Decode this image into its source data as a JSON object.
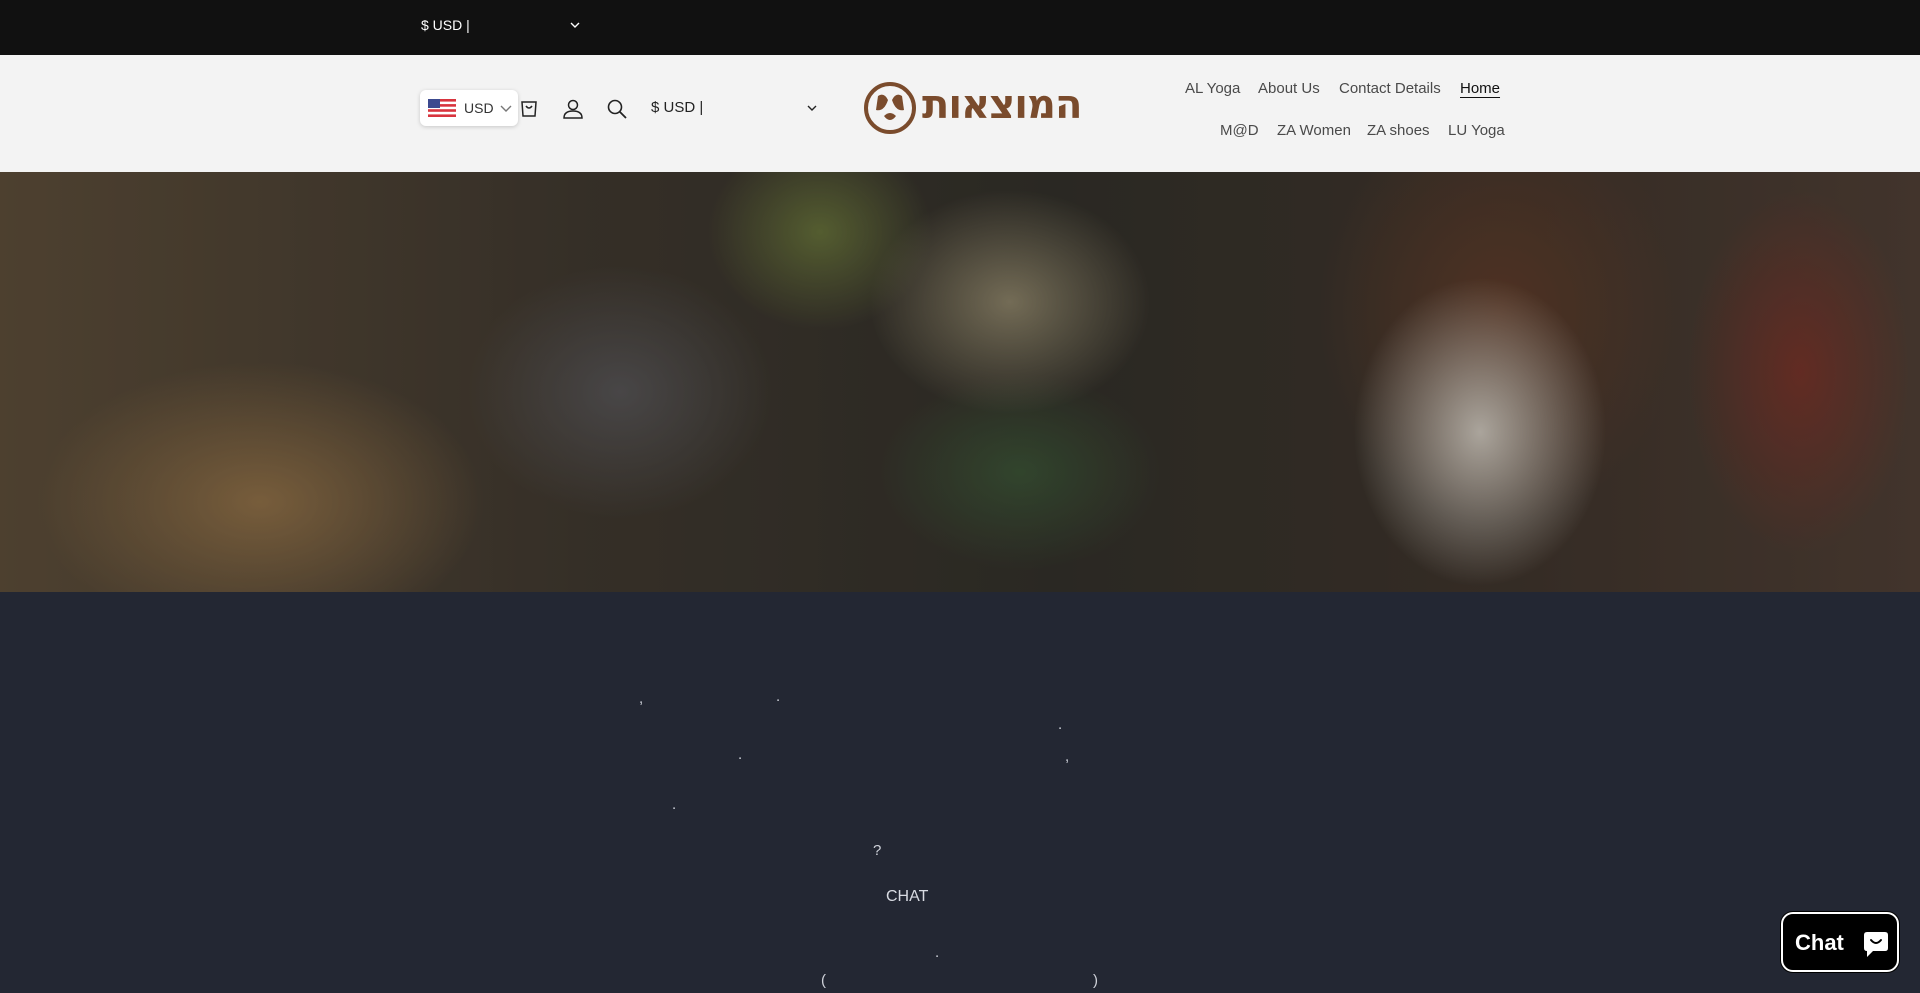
{
  "announcement": {
    "currency": "$ USD |"
  },
  "currency_pill": {
    "label": "USD"
  },
  "header": {
    "currency": "$ USD |",
    "logo_text": "המוצאות",
    "nav": [
      {
        "label": "AL Yoga"
      },
      {
        "label": "About Us"
      },
      {
        "label": "Contact Details"
      },
      {
        "label": "Home"
      },
      {
        "label": "M@D"
      },
      {
        "label": "ZA Women"
      },
      {
        "label": "ZA shoes"
      },
      {
        "label": "LU Yoga"
      }
    ]
  },
  "content": {
    "punctuation": [
      ",",
      ".",
      ".",
      ".",
      ",",
      ".",
      "?",
      ".",
      "(",
      ")"
    ],
    "chat_word": "CHAT"
  },
  "chat_widget": {
    "label": "Chat"
  },
  "colors": {
    "announcement_bg": "#111111",
    "header_bg": "#f3f3f3",
    "logo_brown": "#7a4b2c",
    "content_bg": "#232733",
    "chat_bg": "#000000"
  }
}
